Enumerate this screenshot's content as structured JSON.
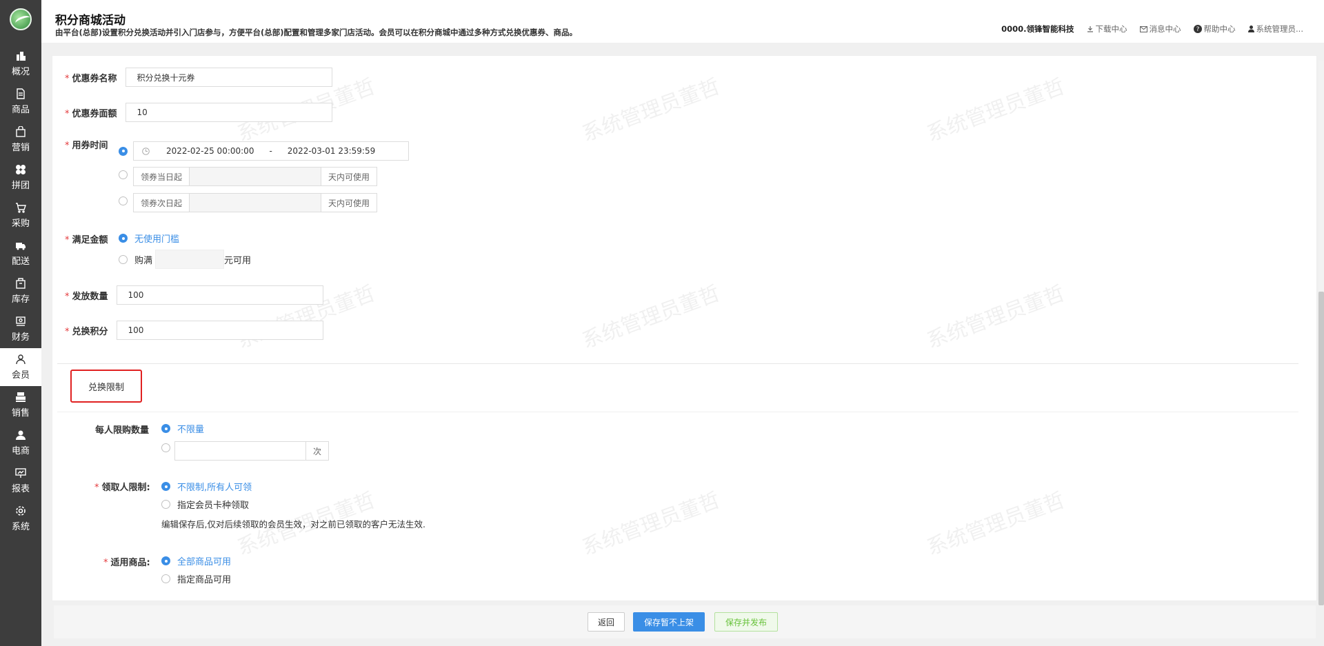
{
  "sidebar": {
    "items": [
      {
        "label": "概况",
        "icon": "building-icon"
      },
      {
        "label": "商品",
        "icon": "document-icon"
      },
      {
        "label": "营销",
        "icon": "bag-icon"
      },
      {
        "label": "拼团",
        "icon": "grid-icon"
      },
      {
        "label": "采购",
        "icon": "cart-icon"
      },
      {
        "label": "配送",
        "icon": "truck-icon"
      },
      {
        "label": "库存",
        "icon": "box-icon"
      },
      {
        "label": "财务",
        "icon": "money-icon"
      },
      {
        "label": "会员",
        "icon": "user-icon"
      },
      {
        "label": "销售",
        "icon": "register-icon"
      },
      {
        "label": "电商",
        "icon": "person-icon"
      },
      {
        "label": "报表",
        "icon": "presentation-icon"
      },
      {
        "label": "系统",
        "icon": "gear-icon"
      }
    ],
    "active": "会员"
  },
  "header": {
    "title": "积分商城活动",
    "description": "由平台(总部)设置积分兑换活动并引入门店参与，方便平台(总部)配置和管理多家门店活动。会员可以在积分商城中通过多种方式兑换优惠券、商品。",
    "company": "0000.领锋智能科技",
    "download": "下载中心",
    "messages": "消息中心",
    "help": "帮助中心",
    "user": "系统管理员..."
  },
  "form": {
    "coupon_name_label": "优惠券名称",
    "coupon_name_value": "积分兑换十元券",
    "coupon_value_label": "优惠券面额",
    "coupon_value_value": "10",
    "use_time_label": "用券时间",
    "date_start": "2022-02-25 00:00:00",
    "date_sep": "-",
    "date_end": "2022-03-01 23:59:59",
    "same_day_prefix": "领券当日起",
    "next_day_prefix": "领券次日起",
    "days_suffix": "天内可使用",
    "threshold_label": "满足金额",
    "no_threshold": "无使用门槛",
    "full_prefix": "购满",
    "full_suffix": "元可用",
    "quantity_label": "发放数量",
    "quantity_value": "100",
    "points_label": "兑换积分",
    "points_value": "100"
  },
  "limits": {
    "tab_label": "兑换限制",
    "per_person_label": "每人限购数量",
    "unlimited": "不限量",
    "times_suffix": "次",
    "receiver_label": "领取人限制:",
    "receiver_any": "不限制,所有人可领",
    "receiver_card": "指定会员卡种领取",
    "note": "编辑保存后,仅对后续领取的会员生效，对之前已领取的客户无法生效.",
    "goods_label": "适用商品:",
    "goods_all": "全部商品可用",
    "goods_specific": "指定商品可用"
  },
  "footer": {
    "back": "返回",
    "save_unpublished": "保存暂不上架",
    "save_publish": "保存并发布"
  },
  "watermark": "系统管理员董哲",
  "colors": {
    "accent": "#3a8ee6",
    "required": "#e4393c",
    "sidebar": "#3d3d3d",
    "highlight_box": "#e02020"
  }
}
